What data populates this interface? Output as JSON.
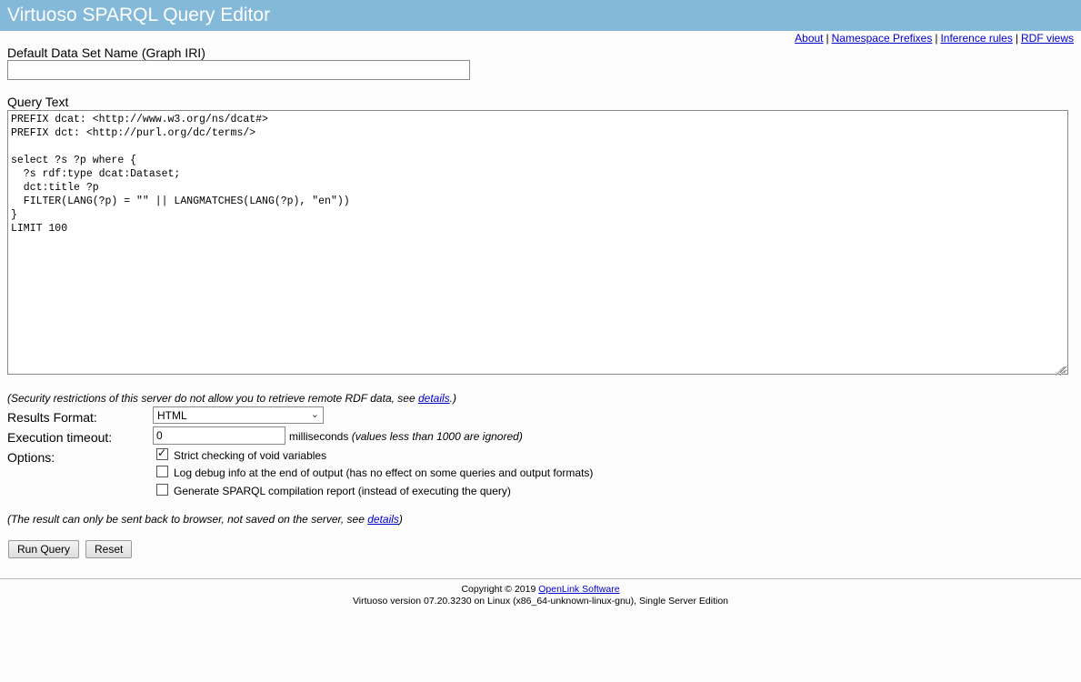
{
  "header": {
    "title": "Virtuoso SPARQL Query Editor"
  },
  "top_links": [
    {
      "label": "About"
    },
    {
      "label": "Namespace Prefixes"
    },
    {
      "label": "Inference rules"
    },
    {
      "label": "RDF views"
    }
  ],
  "graph": {
    "label": "Default Data Set Name (Graph IRI)",
    "value": ""
  },
  "query": {
    "label": "Query Text",
    "value": "PREFIX dcat: <http://www.w3.org/ns/dcat#>\nPREFIX dct: <http://purl.org/dc/terms/>\n\nselect ?s ?p where {\n  ?s rdf:type dcat:Dataset;\n  dct:title ?p\n  FILTER(LANG(?p) = \"\" || LANGMATCHES(LANG(?p), \"en\"))\n}\nLIMIT 100"
  },
  "security_note": {
    "text": "(Security restrictions of this server do not allow you to retrieve remote RDF data, see ",
    "link": "details",
    "suffix": ".)"
  },
  "results_format": {
    "label": "Results Format:",
    "selected": "HTML"
  },
  "timeout": {
    "label": "Execution timeout:",
    "value": "0",
    "unit": "milliseconds",
    "hint": "(values less than 1000 are ignored)"
  },
  "options": {
    "label": "Options:",
    "items": [
      {
        "label": "Strict checking of void variables",
        "checked": true
      },
      {
        "label": "Log debug info at the end of output (has no effect on some queries and output formats)",
        "checked": false
      },
      {
        "label": "Generate SPARQL compilation report (instead of executing the query)",
        "checked": false
      }
    ]
  },
  "result_note": {
    "text": "(The result can only be sent back to browser, not saved on the server, see ",
    "link": "details",
    "suffix": ")"
  },
  "buttons": {
    "run": "Run Query",
    "reset": "Reset"
  },
  "footer": {
    "copyright": "Copyright © 2019 ",
    "company": "OpenLink Software",
    "version": "Virtuoso version 07.20.3230 on Linux (x86_64-unknown-linux-gnu), Single Server Edition"
  },
  "colors": {
    "header_bg": "#84b9d9",
    "link": "#0000cc"
  }
}
